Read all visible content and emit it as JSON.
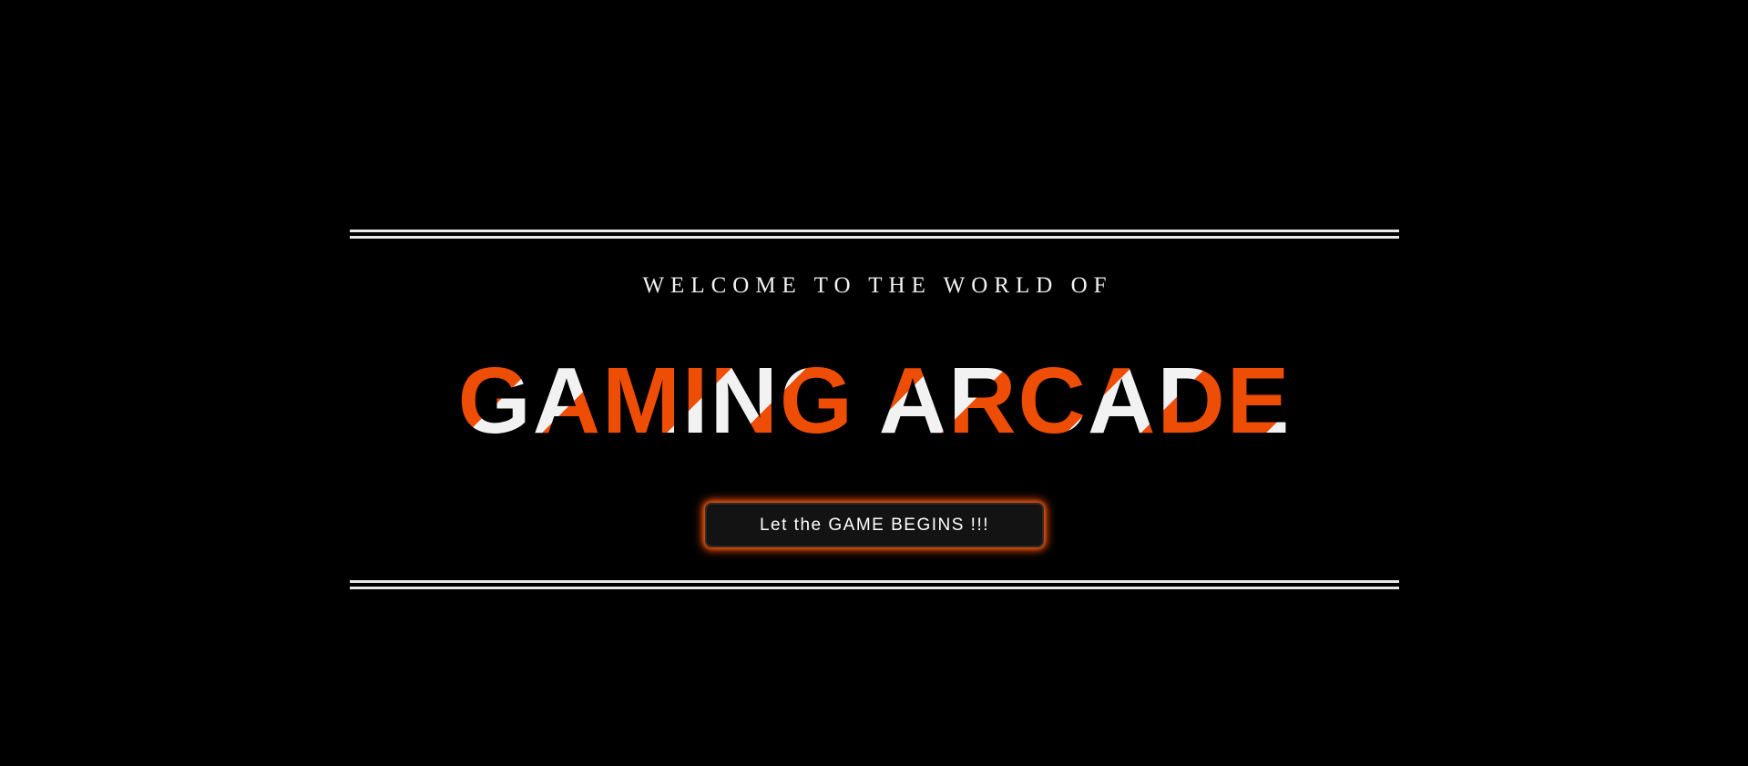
{
  "hero": {
    "subtitle": "WELCOME TO THE WORLD OF",
    "title": "GAMING ARCADE",
    "cta_label": "Let the GAME BEGINS !!!"
  },
  "colors": {
    "background": "#000000",
    "accent": "#ee4d06",
    "text": "#f2f2f2",
    "rule": "#e8e8e8",
    "button_bg": "#131313"
  }
}
